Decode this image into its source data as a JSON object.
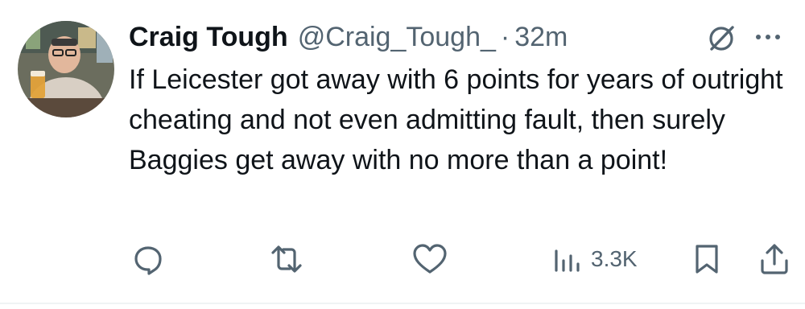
{
  "tweet": {
    "display_name": "Craig Tough",
    "handle": "@Craig_Tough_",
    "separator": "·",
    "time": "32m",
    "text": "If Leicester got away with 6 points for years of outright cheating and not even admitting fault, then surely Baggies get away with no more than a point!",
    "views": "3.3K"
  },
  "icons": {
    "grok": "grok-icon",
    "more": "more-icon",
    "reply": "reply-icon",
    "retweet": "retweet-icon",
    "like": "heart-icon",
    "views": "views-icon",
    "bookmark": "bookmark-icon",
    "share": "share-icon"
  },
  "colors": {
    "text_primary": "#0f1419",
    "text_secondary": "#536471",
    "divider": "#eff3f4"
  }
}
